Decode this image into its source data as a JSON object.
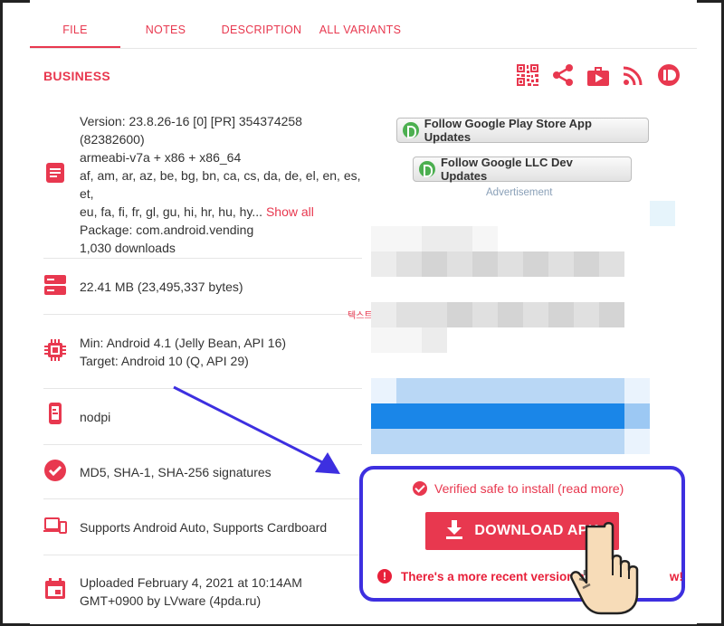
{
  "tabs": [
    {
      "label": "FILE",
      "active": true
    },
    {
      "label": "NOTES"
    },
    {
      "label": "DESCRIPTION"
    },
    {
      "label": "ALL VARIANTS"
    }
  ],
  "section_title": "BUSINESS",
  "share_icons": [
    "qr-code-icon",
    "share-icon",
    "briefcase-play-icon",
    "rss-icon",
    "pushbullet-icon"
  ],
  "details": {
    "version": "Version: 23.8.26-16 [0] [PR] 354374258",
    "version_code": "(82382600)",
    "arch": "armeabi-v7a + x86 + x86_64",
    "langs_1": "af, am, ar, az, be, bg, bn, ca, cs, da, de, el, en, es, et,",
    "langs_2": "eu, fa, fi, fr, gl, gu, hi, hr, hu, hy...",
    "show_all": "Show all",
    "package": "Package: com.android.vending",
    "downloads": "1,030 downloads",
    "size": "22.41 MB (23,495,337 bytes)",
    "min_sdk": "Min: Android 4.1 (Jelly Bean, API 16)",
    "target_sdk": "Target: Android 10 (Q, API 29)",
    "dpi": "nodpi",
    "signatures": "MD5, SHA-1, SHA-256 signatures",
    "supports": "Supports Android Auto, Supports Cardboard",
    "uploaded_1": "Uploaded February 4, 2021 at 10:14AM",
    "uploaded_2": "GMT+0900 by LVware (4pda.ru)"
  },
  "follow": {
    "store": "Follow Google Play Store App Updates",
    "dev": "Follow Google LLC Dev Updates"
  },
  "ad_label": "Advertisement",
  "ad_korean": "텍스트",
  "download": {
    "verified": "Verified safe to install (read more)",
    "button": "DOWNLOAD APK",
    "warning": "There's a more recent version a",
    "warning_tail": "w!"
  },
  "colors": {
    "accent": "#e8384f",
    "highlight_border": "#3d2fe0"
  }
}
